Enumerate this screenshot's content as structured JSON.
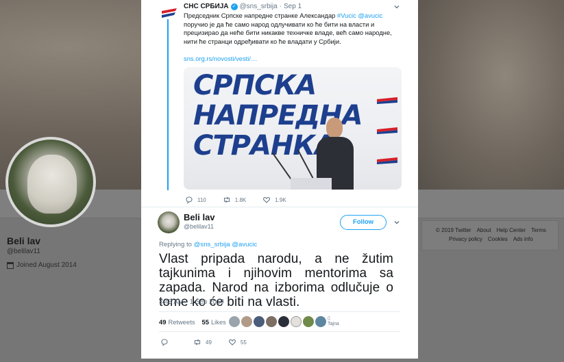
{
  "profile": {
    "name": "Beli lav",
    "handle": "@belilav11",
    "joined": "Joined August 2014"
  },
  "footer": {
    "copyright": "© 2019 Twitter",
    "about": "About",
    "help": "Help Center",
    "terms": "Terms",
    "privacy": "Privacy policy",
    "cookies": "Cookies",
    "ads": "Ads info"
  },
  "quoted_tweet": {
    "author_name": "СНС СРБИЈА",
    "author_handle": "@sns_srbija",
    "dot": "·",
    "date": "Sep 1",
    "text_1": "Председник Српске напредне странке Александар ",
    "hashtag": "#Vucic",
    "mention": "@avucic",
    "text_2": " поручио је да ће само народ одлучивати ко ће бити на власти и прецизирао да неће бити никакве техничке владе, већ само народне, нити ће странци одређивати ко ће владати у Србији.",
    "link": "sns.org.rs/novosti/vesti/…",
    "photo_text": [
      "СРПСКА",
      "НАПРЕДНА",
      "СТРАНКА"
    ],
    "replies": "110",
    "retweets": "1.8K",
    "likes": "1.9K"
  },
  "tweet": {
    "author_name": "Beli lav",
    "author_handle": "@belilav11",
    "follow_label": "Follow",
    "replying_to_label": "Replying to ",
    "replying_to_users": "@sns_srbija @avucic",
    "text": "Vlast pripada narodu, a ne žutim tajkunima i njihovim mentorima sa zapada. Narod na izborima odlučuje o tome ko će biti na vlasti.",
    "timestamp": "3:43 AM - 1 Sep 2019",
    "retweets_count": "49",
    "retweets_label": "Retweets",
    "likes_count": "55",
    "likes_label": "Likes",
    "liker_alt": "Tajna",
    "retweets_action": "49",
    "likes_action": "55"
  },
  "colors": {
    "accent": "#1da1f2",
    "text": "#14171a",
    "muted": "#657786"
  }
}
